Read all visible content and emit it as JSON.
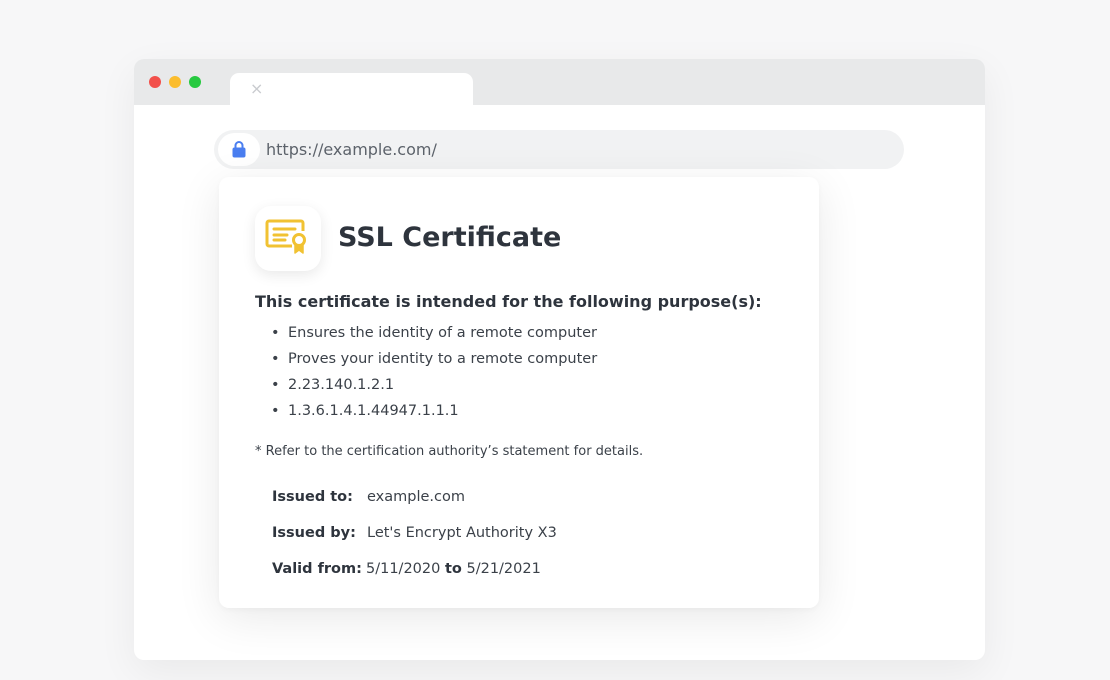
{
  "browser": {
    "tab_close_glyph": "×",
    "url": "https://example.com/",
    "colors": {
      "close": "#f2504b",
      "minimize": "#fbbd2e",
      "maximize": "#27c940",
      "lock": "#4a7ef0"
    }
  },
  "certificate": {
    "title": "SSL Certificate",
    "icon": "certificate-icon",
    "icon_color": "#f1c232",
    "purpose_heading": "This certificate is intended for the following purpose(s):",
    "purposes": [
      "Ensures the identity of a remote computer",
      "Proves your identity to a remote computer",
      "2.23.140.1.2.1",
      "1.3.6.1.4.1.44947.1.1.1"
    ],
    "footnote": "* Refer to the certification authority’s statement for details.",
    "issued_to_label": "Issued to:",
    "issued_to": "example.com",
    "issued_by_label": "Issued by:",
    "issued_by": "Let's Encrypt Authority X3",
    "valid_from_label": "Valid from:",
    "valid_from": "5/11/2020",
    "valid_to_word": "to",
    "valid_to": "5/21/2021"
  }
}
